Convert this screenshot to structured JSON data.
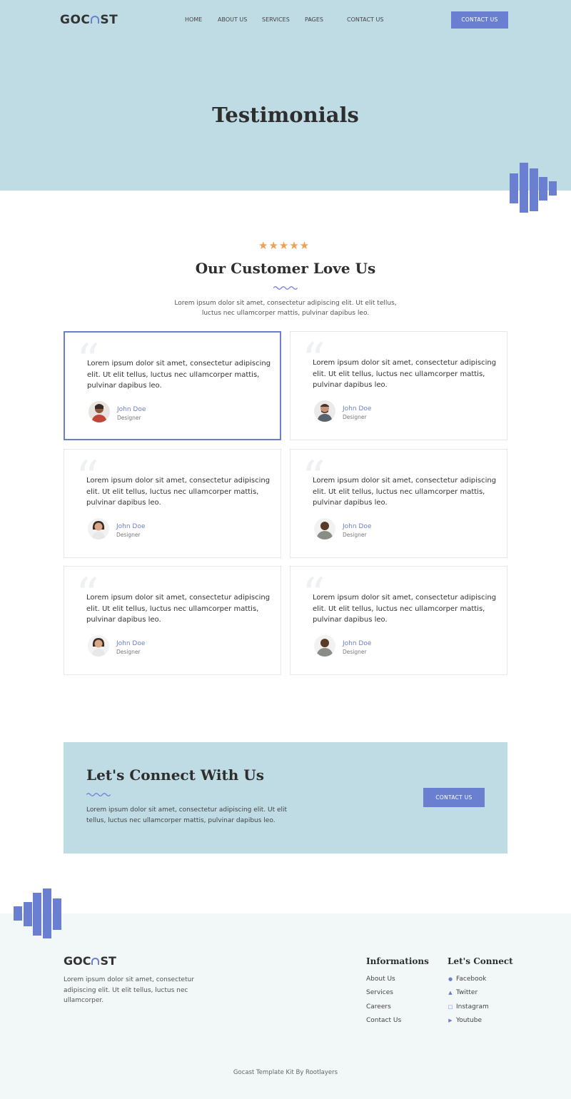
{
  "header": {
    "logo": {
      "left": "GOC",
      "right": "ST"
    },
    "nav": [
      {
        "label": "HOME"
      },
      {
        "label": "ABOUT US"
      },
      {
        "label": "SERVICES"
      },
      {
        "label": "PAGES",
        "has_dropdown": true
      },
      {
        "label": "CONTACT US"
      }
    ],
    "cta_label": "CONTACT US",
    "page_title": "Testimonials"
  },
  "testimonials_section": {
    "rating_stars": "★★★★★",
    "title": "Our Customer Love Us",
    "description": "Lorem ipsum dolor sit amet, consectetur adipiscing elit. Ut elit tellus, luctus nec ullamcorper mattis, pulvinar dapibus leo.",
    "cards": [
      {
        "quote_mark": "“",
        "text": "Lorem ipsum dolor sit amet, consectetur adipiscing elit. Ut elit tellus, luctus nec ullamcorper mattis, pulvinar dapibus leo.",
        "name": "John Doe",
        "role": "Designer",
        "active": true
      },
      {
        "quote_mark": "“",
        "text": "Lorem ipsum dolor sit amet, consectetur adipiscing elit. Ut elit tellus, luctus nec ullamcorper mattis, pulvinar dapibus leo.",
        "name": "John Doe",
        "role": "Designer",
        "active": false
      },
      {
        "quote_mark": "“",
        "text": "Lorem ipsum dolor sit amet, consectetur adipiscing elit. Ut elit tellus, luctus nec ullamcorper mattis, pulvinar dapibus leo.",
        "name": "John Doe",
        "role": "Designer",
        "active": false
      },
      {
        "quote_mark": "“",
        "text": "Lorem ipsum dolor sit amet, consectetur adipiscing elit. Ut elit tellus, luctus nec ullamcorper mattis, pulvinar dapibus leo.",
        "name": "John Doe",
        "role": "Designer",
        "active": false
      },
      {
        "quote_mark": "“",
        "text": "Lorem ipsum dolor sit amet, consectetur adipiscing elit. Ut elit tellus, luctus nec ullamcorper mattis, pulvinar dapibus leo.",
        "name": "John Doe",
        "role": "Designer",
        "active": false
      },
      {
        "quote_mark": "“",
        "text": "Lorem ipsum dolor sit amet, consectetur adipiscing elit. Ut elit tellus, luctus nec ullamcorper mattis, pulvinar dapibus leo.",
        "name": "John Doe",
        "role": "Designer",
        "active": false
      }
    ]
  },
  "cta_section": {
    "title": "Let's Connect With Us",
    "description": "Lorem ipsum dolor sit amet, consectetur adipiscing elit. Ut elit tellus, luctus nec ullamcorper mattis, pulvinar dapibus leo.",
    "button_label": "CONTACT US"
  },
  "footer": {
    "logo": {
      "left": "GOC",
      "right": "ST"
    },
    "description": "Lorem ipsum dolor sit amet, consectetur adipiscing elit. Ut elit tellus, luctus nec ullamcorper.",
    "informations": {
      "title": "Informations",
      "links": [
        "About Us",
        "Services",
        "Careers",
        "Contact Us"
      ]
    },
    "connect": {
      "title": "Let's Connect",
      "links": [
        {
          "label": "Facebook",
          "icon": "facebook-icon"
        },
        {
          "label": "Twitter",
          "icon": "twitter-icon"
        },
        {
          "label": "Instagram",
          "icon": "instagram-icon"
        },
        {
          "label": "Youtube",
          "icon": "youtube-icon"
        }
      ]
    },
    "copyright": "Gocast Template Kit By Rootlayers"
  },
  "colors": {
    "accent": "#6b7fd0",
    "hero_bg": "#bfdbe4",
    "star": "#f0a050",
    "footer_bg": "#f2f7f8"
  }
}
